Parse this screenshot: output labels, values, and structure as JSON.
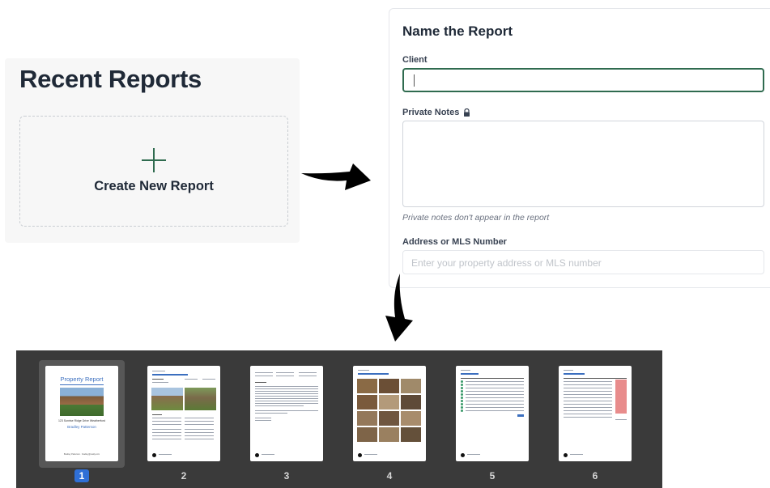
{
  "recent": {
    "title": "Recent Reports",
    "create_label": "Create New Report"
  },
  "form": {
    "title": "Name the Report",
    "client_label": "Client",
    "client_value": "",
    "notes_label": "Private Notes",
    "notes_value": "",
    "notes_hint": "Private notes don't appear in the report",
    "address_label": "Address or MLS Number",
    "address_placeholder": "Enter your property address or MLS number"
  },
  "thumbnails": {
    "selected_page": 1,
    "cover": {
      "title": "Property Report",
      "address": "123 Sunrise Ridge Drive Weatherford",
      "name": "Bradley Patterson",
      "footer": "Bradley Patterson · bradley@realty.com"
    },
    "pages": [
      {
        "number": "1"
      },
      {
        "number": "2"
      },
      {
        "number": "3"
      },
      {
        "number": "4"
      },
      {
        "number": "5"
      },
      {
        "number": "6"
      }
    ]
  },
  "colors": {
    "accent_green": "#2f6b4f",
    "strip_bg": "#3a3a3a",
    "selected_badge": "#2f6fd6",
    "report_blue": "#3b6fbf"
  },
  "icons": {
    "create": "plus-icon",
    "notes_label_icon": "lock-icon",
    "flow_right": "curved-arrow-right-icon",
    "flow_down": "curved-arrow-down-icon"
  }
}
